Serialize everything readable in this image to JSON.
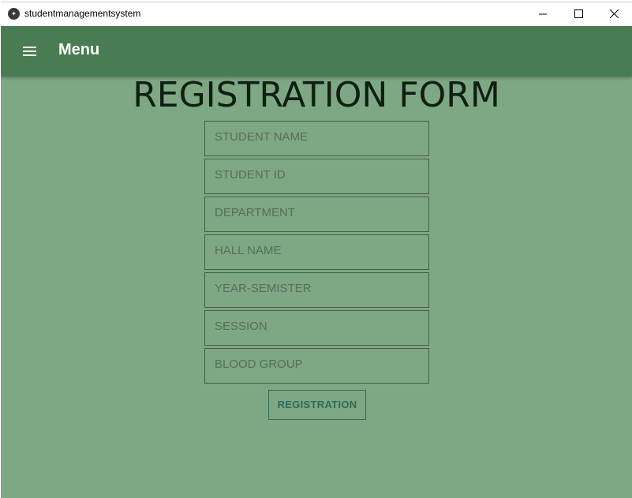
{
  "window": {
    "title": "studentmanagementsystem",
    "app_icon": "kivy-app-icon",
    "controls": {
      "minimize_icon": "minimize-icon",
      "maximize_icon": "maximize-icon",
      "close_icon": "close-icon"
    }
  },
  "toolbar": {
    "menu_icon": "hamburger-menu-icon",
    "title": "Menu"
  },
  "form": {
    "title": "REGISTRATION FORM",
    "fields": [
      {
        "placeholder": "STUDENT NAME",
        "value": ""
      },
      {
        "placeholder": "STUDENT ID",
        "value": ""
      },
      {
        "placeholder": "DEPARTMENT",
        "value": ""
      },
      {
        "placeholder": "HALL NAME",
        "value": ""
      },
      {
        "placeholder": "YEAR-SEMISTER",
        "value": ""
      },
      {
        "placeholder": "SESSION",
        "value": ""
      },
      {
        "placeholder": "BLOOD GROUP",
        "value": ""
      }
    ],
    "submit_label": "REGISTRATION"
  },
  "colors": {
    "background": "#7ea884",
    "toolbar": "#4a7c53",
    "button_text": "#2d6a5c"
  }
}
